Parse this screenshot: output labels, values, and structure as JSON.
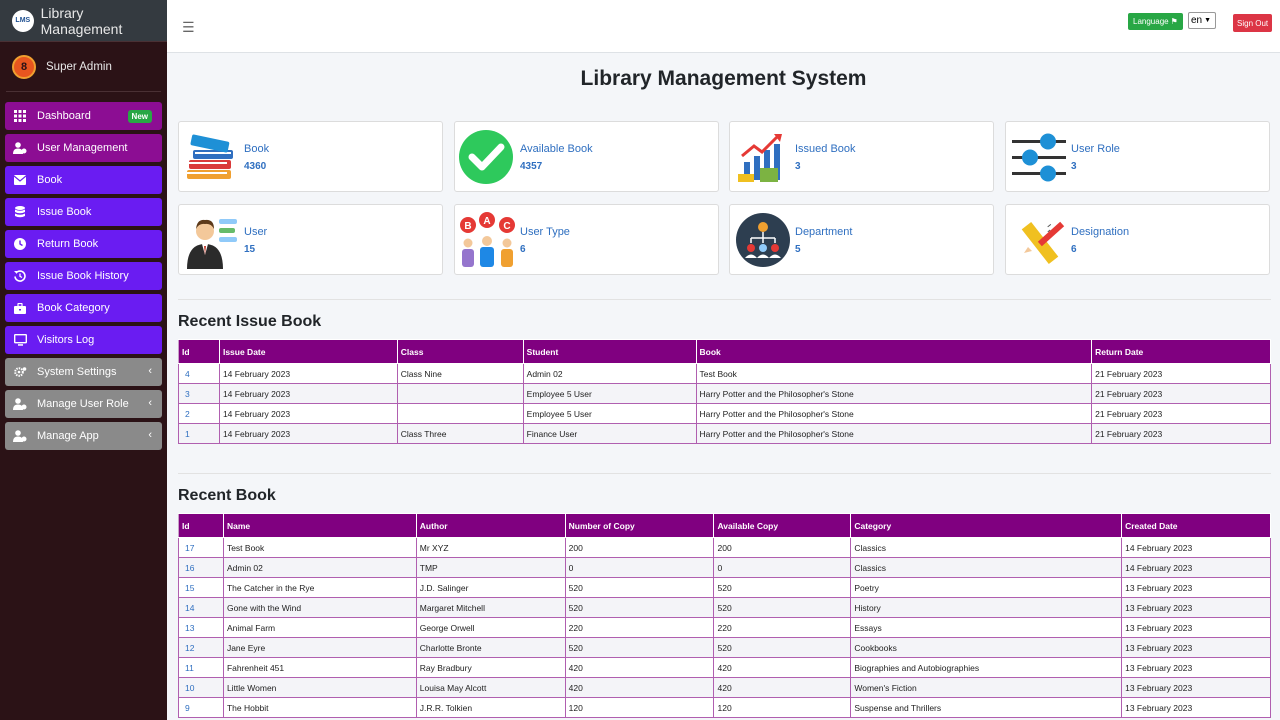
{
  "brand": {
    "title": "Library Management",
    "logo_text": "LMS"
  },
  "user": {
    "name": "Super Admin",
    "avatar_glyph": "8"
  },
  "sidebar": {
    "items": [
      {
        "label": "Dashboard",
        "badge": "New",
        "icon": "grid-icon",
        "color": "#8c0d93"
      },
      {
        "label": "User Management",
        "icon": "users-icon",
        "color": "#8c0d93"
      },
      {
        "label": "Book",
        "icon": "envelope-icon",
        "color": "#6a1cf2"
      },
      {
        "label": "Issue Book",
        "icon": "database-icon",
        "color": "#6a1cf2"
      },
      {
        "label": "Return Book",
        "icon": "clock-icon",
        "color": "#6a1cf2"
      },
      {
        "label": "Issue Book History",
        "icon": "history-icon",
        "color": "#6a1cf2"
      },
      {
        "label": "Book Category",
        "icon": "briefcase-icon",
        "color": "#6a1cf2"
      },
      {
        "label": "Visitors Log",
        "icon": "monitor-icon",
        "color": "#6a1cf2"
      },
      {
        "label": "System Settings",
        "icon": "cogs-icon",
        "color": "#8a8a8a"
      },
      {
        "label": "Manage User Role",
        "icon": "users-icon",
        "color": "#8a8a8a"
      },
      {
        "label": "Manage App",
        "icon": "users-icon",
        "color": "#8a8a8a"
      }
    ]
  },
  "header": {
    "language_label": "Language",
    "language_value": "en",
    "signout_label": "Sign Out"
  },
  "page": {
    "title": "Library Management System"
  },
  "stats": [
    {
      "label": "Book",
      "value": "4360",
      "icon": "books-stack-icon"
    },
    {
      "label": "Available Book",
      "value": "4357",
      "icon": "check-circle-icon"
    },
    {
      "label": "Issued Book",
      "value": "3",
      "icon": "growth-chart-icon"
    },
    {
      "label": "User Role",
      "value": "3",
      "icon": "sliders-icon"
    },
    {
      "label": "User",
      "value": "15",
      "icon": "businessman-icon"
    },
    {
      "label": "User Type",
      "value": "6",
      "icon": "abc-users-icon"
    },
    {
      "label": "Department",
      "value": "5",
      "icon": "org-chart-icon"
    },
    {
      "label": "Designation",
      "value": "6",
      "icon": "ruler-pencil-icon"
    }
  ],
  "recent_issue": {
    "title": "Recent Issue Book",
    "columns": [
      "Id",
      "Issue Date",
      "Class",
      "Student",
      "Book",
      "Return Date"
    ],
    "rows": [
      [
        "4",
        "14 February 2023",
        "Class Nine",
        "Admin 02",
        "Test Book",
        "21 February 2023"
      ],
      [
        "3",
        "14 February 2023",
        "",
        "Employee 5 User",
        "Harry Potter and the Philosopher's Stone",
        "21 February 2023"
      ],
      [
        "2",
        "14 February 2023",
        "",
        "Employee 5 User",
        "Harry Potter and the Philosopher's Stone",
        "21 February 2023"
      ],
      [
        "1",
        "14 February 2023",
        "Class Three",
        "Finance User",
        "Harry Potter and the Philosopher's Stone",
        "21 February 2023"
      ]
    ]
  },
  "recent_book": {
    "title": "Recent Book",
    "columns": [
      "Id",
      "Name",
      "Author",
      "Number of Copy",
      "Available Copy",
      "Category",
      "Created Date"
    ],
    "rows": [
      [
        "17",
        "Test Book",
        "Mr XYZ",
        "200",
        "200",
        "Classics",
        "14 February 2023"
      ],
      [
        "16",
        "Admin 02",
        "TMP",
        "0",
        "0",
        "Classics",
        "14 February 2023"
      ],
      [
        "15",
        "The Catcher in the Rye",
        "J.D. Salinger",
        "520",
        "520",
        "Poetry",
        "13 February 2023"
      ],
      [
        "14",
        "Gone with the Wind",
        "Margaret Mitchell",
        "520",
        "520",
        "History",
        "13 February 2023"
      ],
      [
        "13",
        "Animal Farm",
        "George Orwell",
        "220",
        "220",
        "Essays",
        "13 February 2023"
      ],
      [
        "12",
        "Jane Eyre",
        "Charlotte Bronte",
        "520",
        "520",
        "Cookbooks",
        "13 February 2023"
      ],
      [
        "11",
        "Fahrenheit 451",
        "Ray Bradbury",
        "420",
        "420",
        "Biographies and Autobiographies",
        "13 February 2023"
      ],
      [
        "10",
        "Little Women",
        "Louisa May Alcott",
        "420",
        "420",
        "Women's Fiction",
        "13 February 2023"
      ],
      [
        "9",
        "The Hobbit",
        "J.R.R. Tolkien",
        "120",
        "120",
        "Suspense and Thrillers",
        "13 February 2023"
      ]
    ]
  }
}
